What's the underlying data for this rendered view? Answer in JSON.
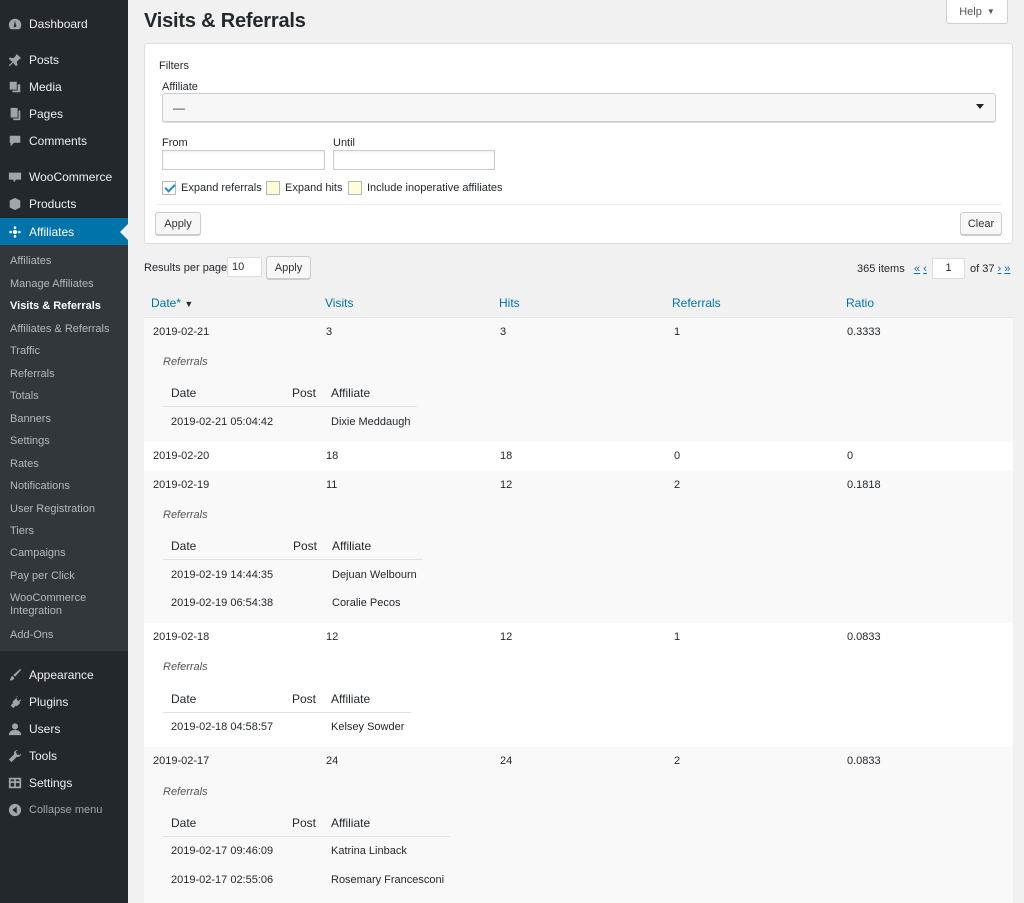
{
  "colors": {
    "sidebar": "#23282d",
    "submenu": "#32373c",
    "accent": "#0073aa",
    "link": "#0073aa"
  },
  "menu": {
    "dashboard": "Dashboard",
    "posts": "Posts",
    "media": "Media",
    "pages": "Pages",
    "comments": "Comments",
    "woocommerce": "WooCommerce",
    "products": "Products",
    "affiliates": "Affiliates",
    "appearance": "Appearance",
    "plugins": "Plugins",
    "users": "Users",
    "tools": "Tools",
    "settings": "Settings",
    "collapse": "Collapse menu"
  },
  "submenu": [
    "Affiliates",
    "Manage Affiliates",
    "Visits & Referrals",
    "Affiliates & Referrals",
    "Traffic",
    "Referrals",
    "Totals",
    "Banners",
    "Settings",
    "Rates",
    "Notifications",
    "User Registration",
    "Tiers",
    "Campaigns",
    "Pay per Click",
    "WooCommerce Integration",
    "Add-Ons"
  ],
  "page": {
    "title": "Visits & Referrals",
    "help": "Help"
  },
  "filters": {
    "title": "Filters",
    "affiliate_label": "Affiliate",
    "affiliate_value": "—",
    "from_label": "From",
    "until_label": "Until",
    "expand_referrals": "Expand referrals",
    "expand_hits": "Expand hits",
    "include_inoperative": "Include inoperative affiliates",
    "expand_referrals_checked": true,
    "expand_hits_checked": false,
    "include_inoperative_checked": false,
    "apply": "Apply",
    "clear": "Clear"
  },
  "results": {
    "label": "Results per page",
    "value": "10",
    "apply": "Apply"
  },
  "pagination": {
    "items": "365 items",
    "first": "«",
    "prev": "‹",
    "page": "1",
    "of": "of 37",
    "next": "›",
    "last": "»"
  },
  "columns": {
    "date": "Date*",
    "visits": "Visits",
    "hits": "Hits",
    "referrals": "Referrals",
    "ratio": "Ratio"
  },
  "sub_headers": {
    "title": "Referrals",
    "date": "Date",
    "post": "Post",
    "affiliate": "Affiliate"
  },
  "rows": [
    {
      "date": "2019-02-21",
      "visits": "3",
      "hits": "3",
      "referrals": "1",
      "ratio": "0.3333",
      "details": [
        {
          "date": "2019-02-21 05:04:42",
          "affiliate": "Dixie Meddaugh"
        }
      ]
    },
    {
      "date": "2019-02-20",
      "visits": "18",
      "hits": "18",
      "referrals": "0",
      "ratio": "0",
      "details": []
    },
    {
      "date": "2019-02-19",
      "visits": "11",
      "hits": "12",
      "referrals": "2",
      "ratio": "0.1818",
      "details": [
        {
          "date": "2019-02-19 14:44:35",
          "affiliate": "Dejuan Welbourn"
        },
        {
          "date": "2019-02-19 06:54:38",
          "affiliate": "Coralie Pecos"
        }
      ]
    },
    {
      "date": "2019-02-18",
      "visits": "12",
      "hits": "12",
      "referrals": "1",
      "ratio": "0.0833",
      "details": [
        {
          "date": "2019-02-18 04:58:57",
          "affiliate": "Kelsey Sowder"
        }
      ]
    },
    {
      "date": "2019-02-17",
      "visits": "24",
      "hits": "24",
      "referrals": "2",
      "ratio": "0.0833",
      "details": [
        {
          "date": "2019-02-17 09:46:09",
          "affiliate": "Katrina Linback"
        },
        {
          "date": "2019-02-17 02:55:06",
          "affiliate": "Rosemary Francesconi"
        }
      ]
    }
  ]
}
